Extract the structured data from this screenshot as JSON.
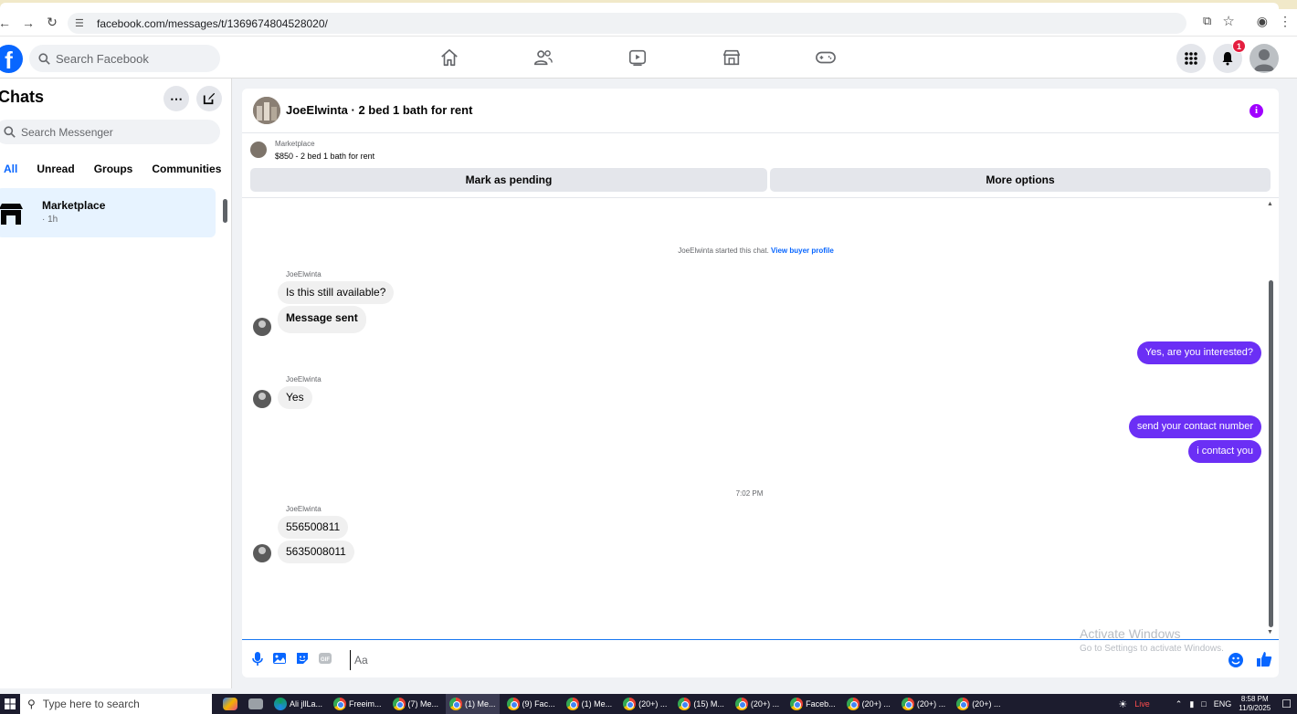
{
  "browser": {
    "url": "facebook.com/messages/t/1369674804528020/"
  },
  "header": {
    "logo": "f",
    "search_placeholder": "Search Facebook",
    "notification_count": "1",
    "nav_icons": [
      "home-icon",
      "friends-icon",
      "video-icon",
      "marketplace-icon",
      "gaming-icon"
    ]
  },
  "sidebar": {
    "title": "Chats",
    "search_placeholder": "Search Messenger",
    "filters": [
      "All",
      "Unread",
      "Groups",
      "Communities"
    ],
    "active_filter": "All",
    "chats": [
      {
        "name": "Marketplace",
        "time": "· 1h"
      }
    ]
  },
  "conversation": {
    "title": "JoeElwinta · 2 bed 1 bath for rent",
    "marketplace_label": "Marketplace",
    "listing": "$850 - 2 bed 1 bath for rent",
    "btn_pending": "Mark as pending",
    "btn_more": "More options",
    "started_text": "JoeElwinta started this chat. ",
    "view_profile": "View buyer profile",
    "sender_name": "JoeElwinta",
    "msg_available": "Is this still available?",
    "msg_sent": "Message sent",
    "msg_interested": "Yes, are you interested?",
    "msg_yes": "Yes",
    "msg_send_contact": "send your contact number",
    "msg_i_contact": "i contact you",
    "time_divider": "7:02 PM",
    "msg_num1": "556500811",
    "msg_num2": "5635008011",
    "composer_placeholder": "Aa"
  },
  "watermark": {
    "line1": "Activate Windows",
    "line2": "Go to Settings to activate Windows."
  },
  "taskbar": {
    "search_placeholder": "Type here to search",
    "apps": [
      "Ali jllLa...",
      "Freeim...",
      "(7) Me...",
      "(1) Me...",
      "(9) Fac...",
      "(1) Me...",
      "(20+) ...",
      "(15) M...",
      "(20+) ...",
      "Faceb...",
      "(20+) ...",
      "(20+) ...",
      "(20+) ..."
    ],
    "live": "Live",
    "lang": "ENG",
    "time": "8:58 PM",
    "date": "11/9/2025"
  },
  "colors": {
    "accent": "#0866ff",
    "outgoing_bubble": "#6b2ff5",
    "incoming_bubble": "#f0f0f0"
  }
}
